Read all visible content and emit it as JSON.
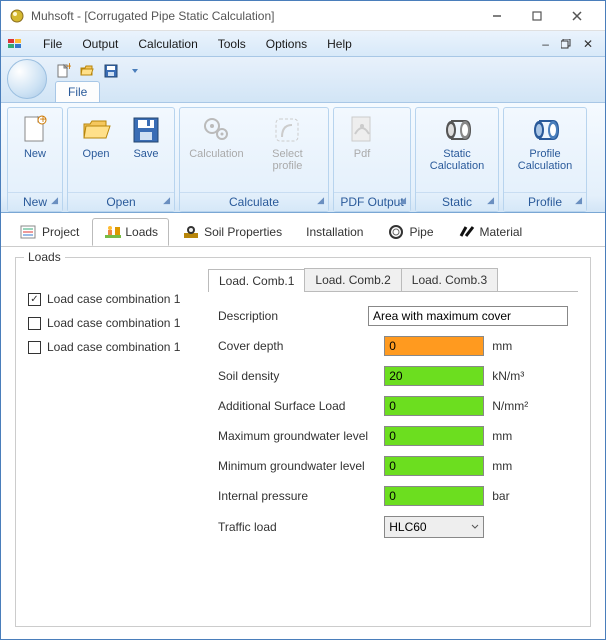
{
  "window": {
    "title": "Muhsoft - [Corrugated Pipe Static Calculation]"
  },
  "menu": {
    "file": "File",
    "output": "Output",
    "calculation": "Calculation",
    "tools": "Tools",
    "options": "Options",
    "help": "Help"
  },
  "quick": {
    "file_tab": "File"
  },
  "ribbon": {
    "new": {
      "label": "New",
      "group": "New"
    },
    "open": {
      "label": "Open"
    },
    "save": {
      "label": "Save",
      "group": "Open"
    },
    "calc": {
      "label": "Calculation"
    },
    "selprof": {
      "label": "Select profile",
      "group": "Calculate"
    },
    "pdf": {
      "label": "Pdf",
      "group": "PDF Output"
    },
    "static": {
      "label": "Static Calculation",
      "group": "Static"
    },
    "profile": {
      "label": "Profile Calculation",
      "group": "Profile"
    }
  },
  "maintabs": {
    "project": "Project",
    "loads": "Loads",
    "soil": "Soil Properties",
    "install": "Installation",
    "pipe": "Pipe",
    "material": "Material"
  },
  "loads": {
    "legend": "Loads",
    "chk1": "Load case combination 1",
    "chk2": "Load case combination 1",
    "chk3": "Load case combination 1",
    "subtabs": {
      "c1": "Load. Comb.1",
      "c2": "Load. Comb.2",
      "c3": "Load. Comb.3"
    },
    "fields": {
      "description": {
        "label": "Description",
        "value": "Area with maximum cover"
      },
      "cover": {
        "label": "Cover depth",
        "value": "0",
        "unit": "mm"
      },
      "density": {
        "label": "Soil density",
        "value": "20",
        "unit": "kN/m³"
      },
      "surface": {
        "label": "Additional Surface Load",
        "value": "0",
        "unit": "N/mm²"
      },
      "maxgw": {
        "label": "Maximum groundwater level",
        "value": "0",
        "unit": "mm"
      },
      "mingw": {
        "label": "Minimum groundwater level",
        "value": "0",
        "unit": "mm"
      },
      "pressure": {
        "label": "Internal pressure",
        "value": "0",
        "unit": "bar"
      },
      "traffic": {
        "label": "Traffic load",
        "value": "HLC60"
      }
    }
  }
}
